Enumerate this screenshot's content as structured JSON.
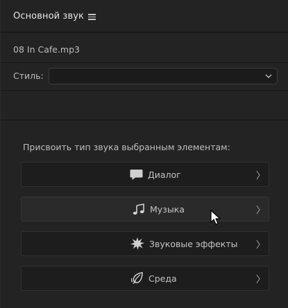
{
  "panel": {
    "title": "Основной звук",
    "menu_icon": "hamburger-menu-icon"
  },
  "clip": {
    "file_name": "08 In Cafe.mp3"
  },
  "style": {
    "label": "Стиль:",
    "selected": ""
  },
  "assign": {
    "label": "Присвоить тип звука выбранным элементам:",
    "buttons": [
      {
        "label": "Диалог",
        "icon": "speech-bubble-icon"
      },
      {
        "label": "Музыка",
        "icon": "music-note-icon"
      },
      {
        "label": "Звуковые эффекты",
        "icon": "starburst-icon"
      },
      {
        "label": "Среда",
        "icon": "ambience-leaf-icon"
      }
    ]
  },
  "colors": {
    "panel_bg": "#232323",
    "text": "#bdbdbd",
    "button_bg": "#1d1d1d"
  }
}
